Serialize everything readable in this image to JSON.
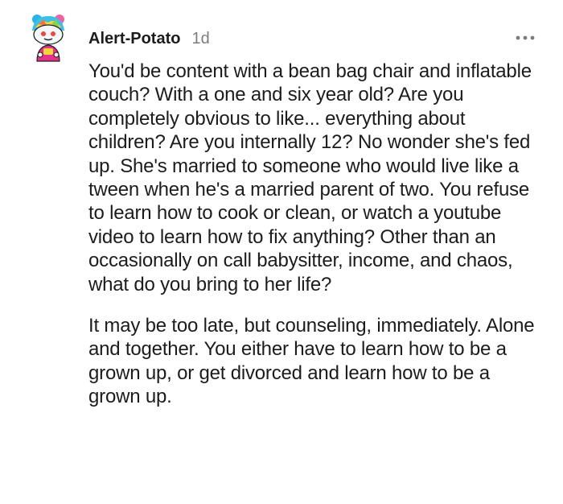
{
  "comment": {
    "username": "Alert-Potato",
    "time": "1d",
    "avatar_icon": "cartoon-snoo-avatar",
    "more_icon": "more-options-ellipsis",
    "paragraphs": [
      "You'd be content with a bean bag chair and inflatable couch? With a one and six year old? Are you completely obvious to like... everything about children? Are you internally 12? No wonder she's fed up. She's married to someone who would live like a tween when he's a married parent of two. You refuse to learn how to cook or clean, or watch a youtube video to learn how to fix anything? Other than an occasionally on call babysitter, income, and chaos, what do you bring to her life?",
      "It may be too late, but counseling, immediately. Alone and together. You either have to learn how to be a grown up, or get divorced and learn how to be a grown up."
    ]
  },
  "colors": {
    "text": "#1c1c1c",
    "meta": "#7c7c7c",
    "background": "#ffffff"
  }
}
